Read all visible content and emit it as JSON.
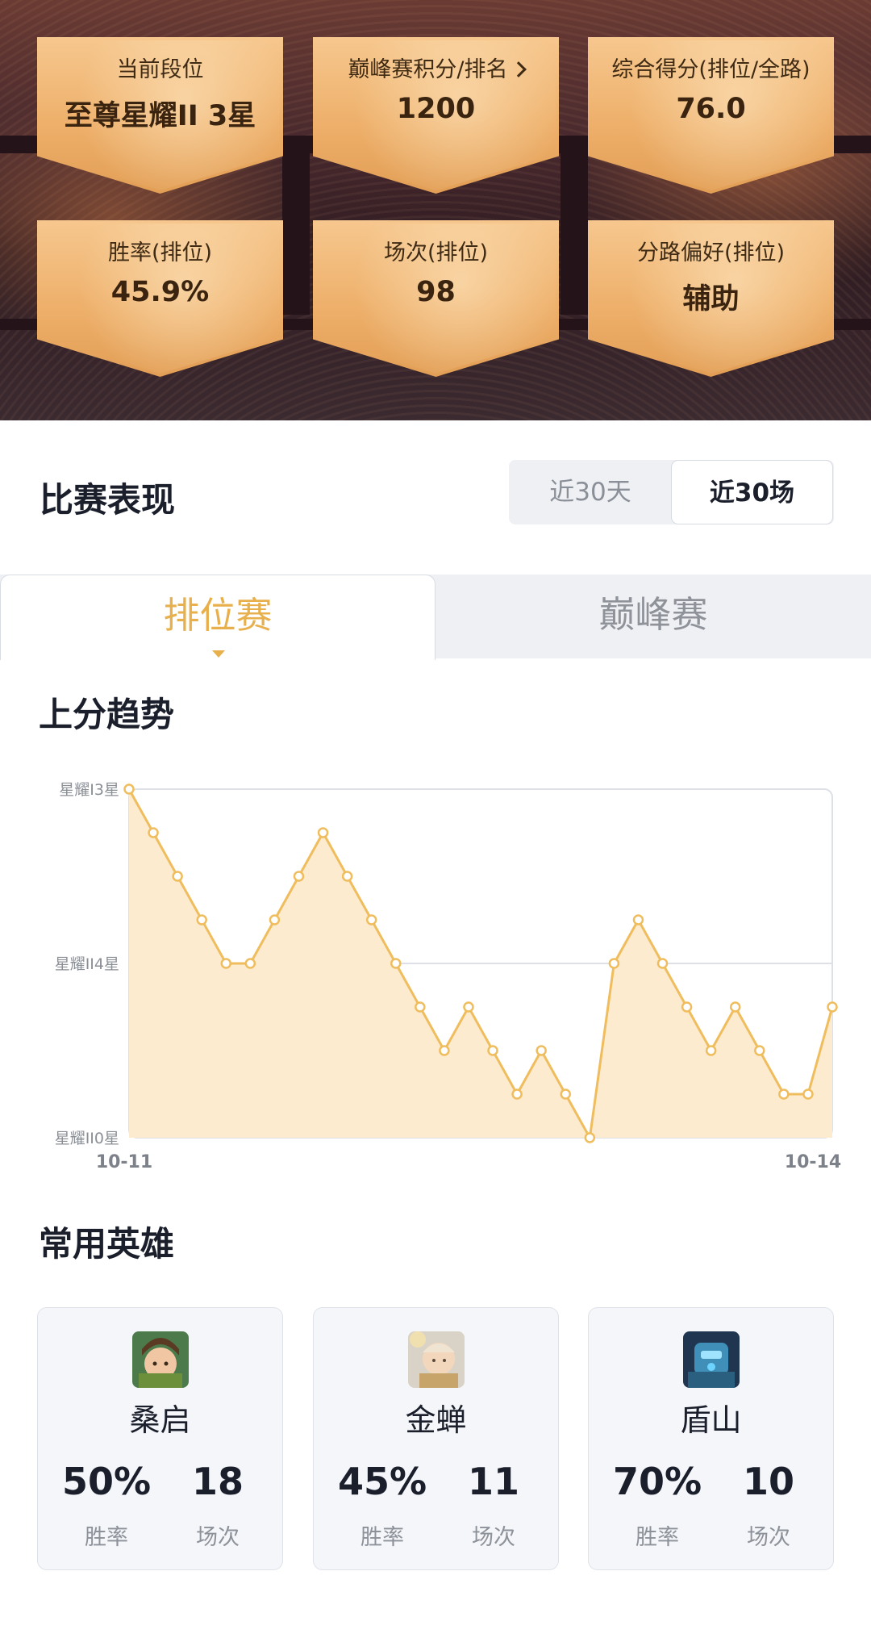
{
  "stats": [
    {
      "label": "当前段位",
      "value": "至尊星耀II 3星",
      "has_arrow": false
    },
    {
      "label": "巅峰赛积分/排名",
      "value": "1200",
      "has_arrow": true
    },
    {
      "label": "综合得分(排位/全路)",
      "value": "76.0",
      "has_arrow": false
    },
    {
      "label": "胜率(排位)",
      "value": "45.9%",
      "has_arrow": false
    },
    {
      "label": "场次(排位)",
      "value": "98",
      "has_arrow": false
    },
    {
      "label": "分路偏好(排位)",
      "value": "辅助",
      "has_arrow": false
    }
  ],
  "performance": {
    "title": "比赛表现",
    "filters": [
      "近30天",
      "近30场"
    ],
    "selected_filter": "近30场"
  },
  "tabs": {
    "items": [
      "排位赛",
      "巅峰赛"
    ],
    "active": "排位赛"
  },
  "trend": {
    "title": "上分趋势"
  },
  "chart_data": {
    "type": "area",
    "y_tick_labels": [
      "星耀II0星",
      "星耀II4星",
      "星耀I3星"
    ],
    "ylim": [
      0,
      8
    ],
    "x_tick_labels": [
      "10-11",
      "10-14"
    ],
    "values": [
      8,
      7,
      6,
      5,
      4,
      4,
      5,
      6,
      7,
      6,
      5,
      4,
      3,
      2,
      3,
      2,
      1,
      2,
      1,
      0,
      4,
      5,
      4,
      3,
      2,
      3,
      2,
      1,
      1,
      3
    ],
    "grid": true,
    "colors": {
      "line": "#efbd5d",
      "fill": "#fdebcf",
      "point_fill": "#ffffff"
    }
  },
  "heroes": {
    "title": "常用英雄",
    "win_rate_label": "胜率",
    "games_label": "场次",
    "items": [
      {
        "name": "桑启",
        "win_rate": "50%",
        "games": "18",
        "avatar_icon": "sangqi-portrait-icon"
      },
      {
        "name": "金蝉",
        "win_rate": "45%",
        "games": "11",
        "avatar_icon": "jinchan-portrait-icon"
      },
      {
        "name": "盾山",
        "win_rate": "70%",
        "games": "10",
        "avatar_icon": "dunshan-portrait-icon"
      }
    ]
  },
  "colors": {
    "accent": "#e8b04d",
    "card_gold": "#eeb06b",
    "text_dark": "#1a1f2b",
    "text_muted": "#8d9199"
  }
}
